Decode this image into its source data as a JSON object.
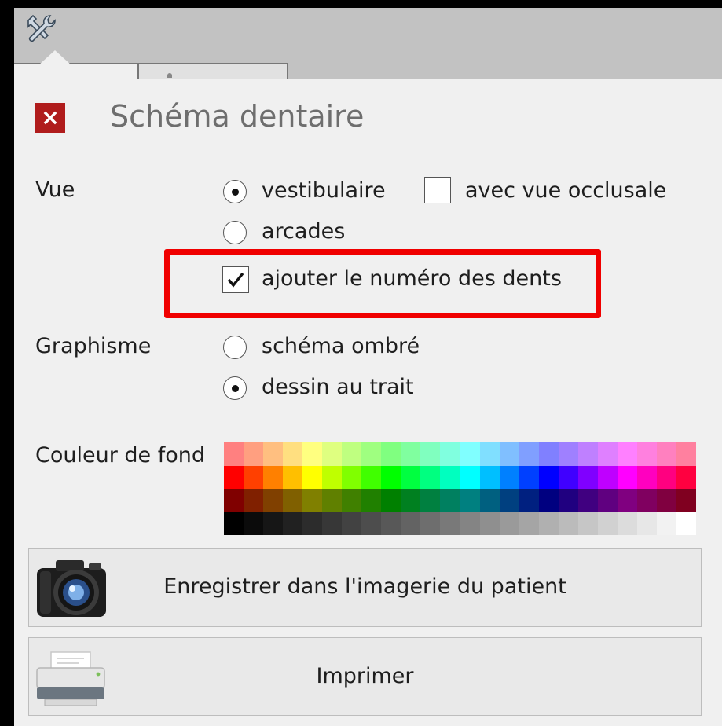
{
  "header": {
    "title": "Schéma dentaire"
  },
  "vue": {
    "label": "Vue",
    "options": [
      {
        "label": "vestibulaire",
        "selected": true
      },
      {
        "label": "arcades",
        "selected": false
      }
    ],
    "occlusal": {
      "label": "avec vue occlusale",
      "checked": false
    },
    "tooth_numbers": {
      "label": "ajouter le numéro des dents",
      "checked": true
    }
  },
  "graphisme": {
    "label": "Graphisme",
    "options": [
      {
        "label": "schéma ombré",
        "selected": false
      },
      {
        "label": "dessin au trait",
        "selected": true
      }
    ]
  },
  "background": {
    "label": "Couleur de fond",
    "palette_rows": [
      [
        "#ff8080",
        "#ff9f80",
        "#ffbf80",
        "#ffdf80",
        "#ffff80",
        "#dfff80",
        "#bfff80",
        "#9fff80",
        "#80ff80",
        "#80ff9f",
        "#80ffbf",
        "#80ffdf",
        "#80ffff",
        "#80dfff",
        "#80bfff",
        "#809fff",
        "#8080ff",
        "#9f80ff",
        "#bf80ff",
        "#df80ff",
        "#ff80ff",
        "#ff80df",
        "#ff80bf",
        "#ff809f"
      ],
      [
        "#ff0000",
        "#ff4000",
        "#ff8000",
        "#ffbf00",
        "#ffff00",
        "#bfff00",
        "#80ff00",
        "#40ff00",
        "#00ff00",
        "#00ff40",
        "#00ff80",
        "#00ffbf",
        "#00ffff",
        "#00bfff",
        "#0080ff",
        "#0040ff",
        "#0000ff",
        "#4000ff",
        "#8000ff",
        "#bf00ff",
        "#ff00ff",
        "#ff00bf",
        "#ff0080",
        "#ff0040"
      ],
      [
        "#800000",
        "#802000",
        "#804000",
        "#806000",
        "#808000",
        "#608000",
        "#408000",
        "#208000",
        "#008000",
        "#008020",
        "#008040",
        "#008060",
        "#008080",
        "#006080",
        "#004080",
        "#002080",
        "#000080",
        "#200080",
        "#400080",
        "#600080",
        "#800080",
        "#800060",
        "#800040",
        "#800020"
      ],
      [
        "#000000",
        "#0b0b0b",
        "#161616",
        "#212121",
        "#2c2c2c",
        "#373737",
        "#424242",
        "#4d4d4d",
        "#585858",
        "#636363",
        "#6e6e6e",
        "#797979",
        "#848484",
        "#8f8f8f",
        "#9a9a9a",
        "#a5a5a5",
        "#b0b0b0",
        "#bbbbbb",
        "#c6c6c6",
        "#d1d1d1",
        "#dcdcdc",
        "#e7e7e7",
        "#f2f2f2",
        "#ffffff"
      ]
    ]
  },
  "actions": {
    "save_label": "Enregistrer dans l'imagerie du patient",
    "print_label": "Imprimer"
  },
  "icons": {
    "toolbar": "tools-icon",
    "close": "close-icon",
    "save": "camera-icon",
    "print": "printer-icon"
  },
  "colors": {
    "close_bg": "#b01c1c",
    "highlight": "#f00000",
    "panel_bg": "#f0f0f0"
  }
}
